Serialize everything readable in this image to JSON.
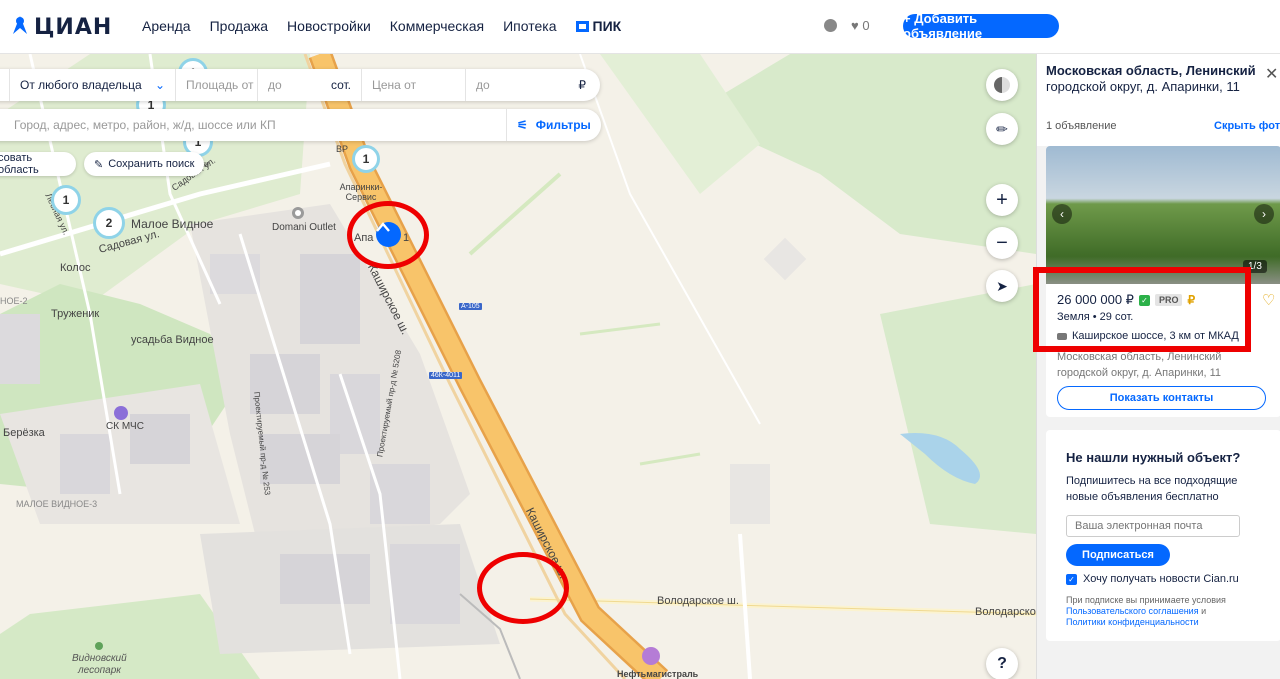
{
  "header": {
    "logo_text": "ЦИАН",
    "nav": [
      "Аренда",
      "Продажа",
      "Новостройки",
      "Коммерческая",
      "Ипотека",
      "ПИК"
    ],
    "favorites_count": "0",
    "add_button": "+ Добавить объявление"
  },
  "filters": {
    "owner": "От любого владельца",
    "area_from": "Площадь от",
    "area_to": "до",
    "area_unit": "сот.",
    "price_from": "Цена от",
    "price_to": "до",
    "currency": "₽",
    "search_placeholder": "Город, адрес, метро, район, ж/д, шоссе или КП",
    "filters_button": "Фильтры",
    "draw_area": "совать область",
    "save_search": "Сохранить поиск"
  },
  "map": {
    "labels": {
      "maloe_vidnoe": "Малое Видное",
      "sadovaya": "Садовая ул.",
      "lesnaya": "Лесная ул.",
      "sadovaya2": "Садовая ул.",
      "kolos": "Колос",
      "truzhenik": "Труженик",
      "usadba": "усадьба Видное",
      "domani": "Domani Outlet",
      "aparinki_service": "Апаринки-Сервис",
      "aparinki": "Апа",
      "aparinki_num": "1",
      "kashirskoe": "Каширское ш.",
      "kashirskoe2": "Каширское ш.",
      "sk_mchs": "СК МЧС",
      "berezka": "Берёзка",
      "maloe_vidnoe_3": "МАЛОЕ ВИДНОЕ-3",
      "noe_2": "НОЕ-2",
      "volodarskoe": "Володарское ш.",
      "volodarskoe2": "Володарское",
      "vidnovsky": "Видновский",
      "lesopark": "лесопарк",
      "neftemagistral": "Нефтьмагистраль",
      "proezd1": "Проектируемый пр-д № 5208",
      "proezd2": "Проектируемый пр-д № 253",
      "ki": "ки",
      "vr": "ВР",
      "sadovaya_ul": "Садовая ул."
    },
    "signs": {
      "a105": "А-105",
      "r46k": "46К-4011"
    },
    "clusters": [
      "1",
      "1",
      "1",
      "1",
      "2",
      "1"
    ],
    "help_button": "?"
  },
  "panel": {
    "title_line1": "Московская область, Ленинский",
    "title_line2": "городской округ, д. Апаринки, 11",
    "count": "1 объявление",
    "photos_link": "Скрыть фото",
    "photo_counter": "1/3",
    "price": "26 000 000 ₽",
    "pro": "PRO",
    "ruble_badge": "₽",
    "props": "Земля  •  29 сот.",
    "highway": "Каширское шоссе, 3 км от МКАД",
    "address": "Московская область, Ленинский городской округ, д. Апаринки, 11",
    "contacts_button": "Показать контакты"
  },
  "subscribe": {
    "title": "Не нашли нужный объект?",
    "text": "Подпишитесь на все подходящие новые объявления бесплатно",
    "email_placeholder": "Ваша электронная почта",
    "button": "Подписаться",
    "news_checkbox": "Хочу получать новости Cian.ru",
    "legal_prefix": "При подписке вы принимаете условия",
    "legal_link1": "Пользовательского соглашения",
    "legal_and": "и",
    "legal_link2": "Политики конфиденциальности"
  },
  "colors": {
    "accent": "#0468ff",
    "annotation": "#ee0000",
    "road_major": "#f5b04c"
  }
}
